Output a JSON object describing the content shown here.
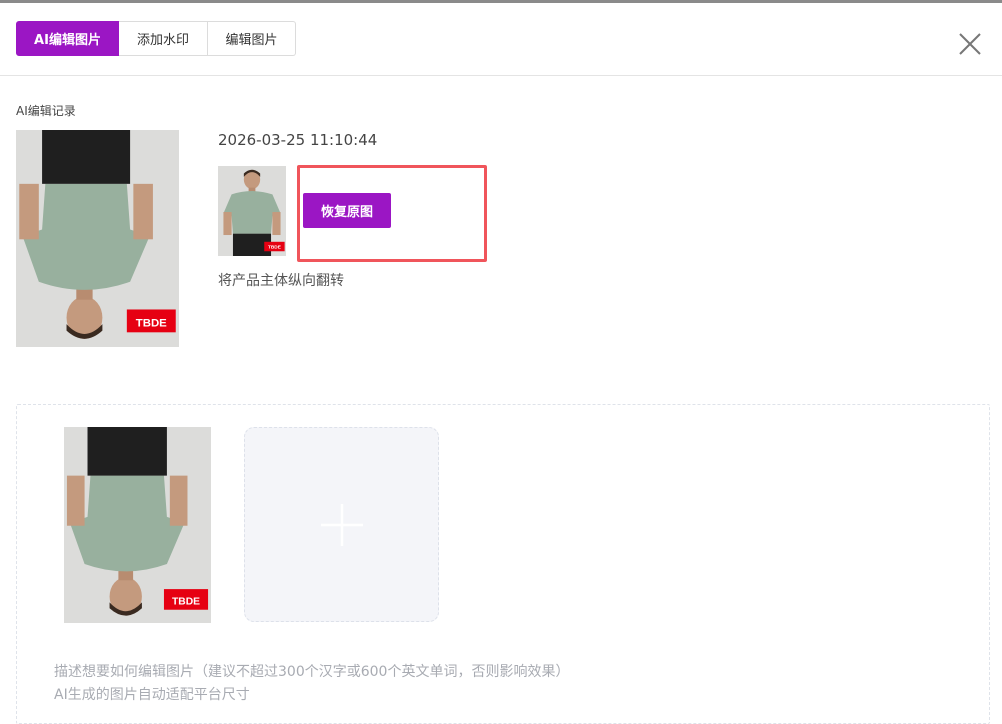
{
  "tabs": [
    {
      "label": "AI编辑图片",
      "active": true
    },
    {
      "label": "添加水印",
      "active": false
    },
    {
      "label": "编辑图片",
      "active": false
    }
  ],
  "icons": {
    "close": "close-icon",
    "upload": "plus-icon"
  },
  "history": {
    "section_label": "AI编辑记录",
    "record": {
      "timestamp": "2026-03-25 11:10:44",
      "restore_label": "恢复原图",
      "description": "将产品主体纵向翻转"
    }
  },
  "product_image": {
    "logo_text": "TBDE"
  },
  "editor": {
    "hint_line1": "描述想要如何编辑图片（建议不超过300个汉字或600个英文单词，否则影响效果）",
    "hint_line2": "AI生成的图片自动适配平台尺寸"
  },
  "colors": {
    "accent": "#9b16c4",
    "highlight": "#f0555b",
    "logo_bg": "#e60012"
  }
}
